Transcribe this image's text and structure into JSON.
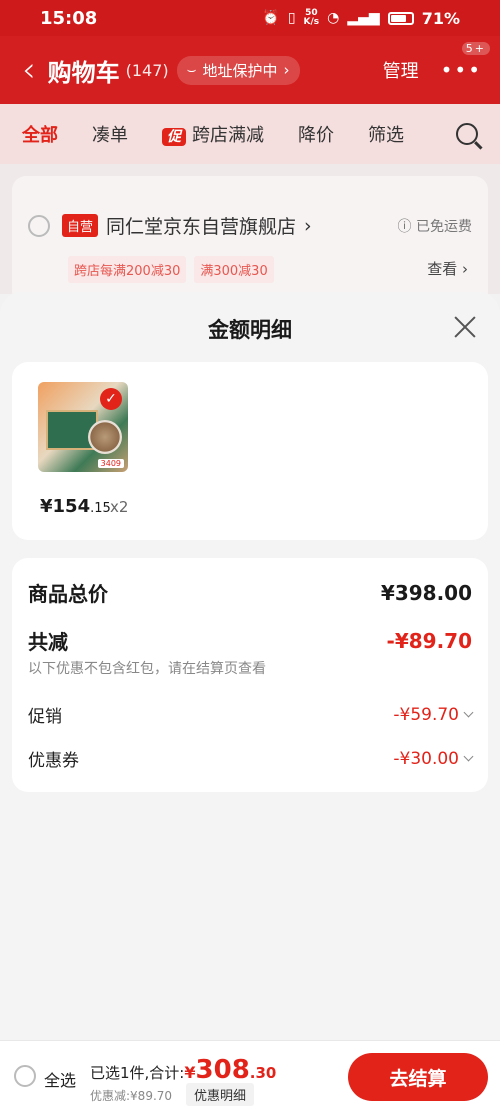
{
  "status": {
    "time": "15:08",
    "speed_top": "50",
    "speed_bottom": "K/s",
    "battery": "71%"
  },
  "header": {
    "title": "购物车",
    "count": "(147)",
    "address_protect": "地址保护中",
    "manage": "管理",
    "more_badge": "5+"
  },
  "tabs": [
    {
      "label": "全部"
    },
    {
      "label": "凑单"
    },
    {
      "tag": "促",
      "label": "跨店满减"
    },
    {
      "label": "降价"
    },
    {
      "label": "筛选"
    }
  ],
  "shop": {
    "tag": "自营",
    "name": "同仁堂京东自营旗舰店",
    "shipping": "已免运费",
    "coupons": [
      "跨店每满200减30",
      "满300减30"
    ],
    "view": "查看"
  },
  "sheet": {
    "title": "金额明细",
    "product": {
      "price_int": "¥154",
      "price_dec": ".15",
      "qty": "x2",
      "img_price": "3409"
    },
    "summary": {
      "total_label": "商品总价",
      "total_value": "¥398.00",
      "reduce_label": "共减",
      "reduce_value": "-¥89.70",
      "note": "以下优惠不包含红包，请在结算页查看",
      "promo_label": "促销",
      "promo_value": "-¥59.70",
      "coupon_label": "优惠券",
      "coupon_value": "-¥30.00"
    }
  },
  "bottom": {
    "select_all": "全选",
    "selected_total": "已选1件,合计:",
    "currency": "¥",
    "total_int": "308",
    "total_dec": ".30",
    "discount": "优惠减:¥89.70",
    "detail_button": "优惠明细",
    "checkout": "去结算"
  },
  "colors": {
    "brand_red": "#e2231a",
    "header_red": "#d31f1f"
  }
}
